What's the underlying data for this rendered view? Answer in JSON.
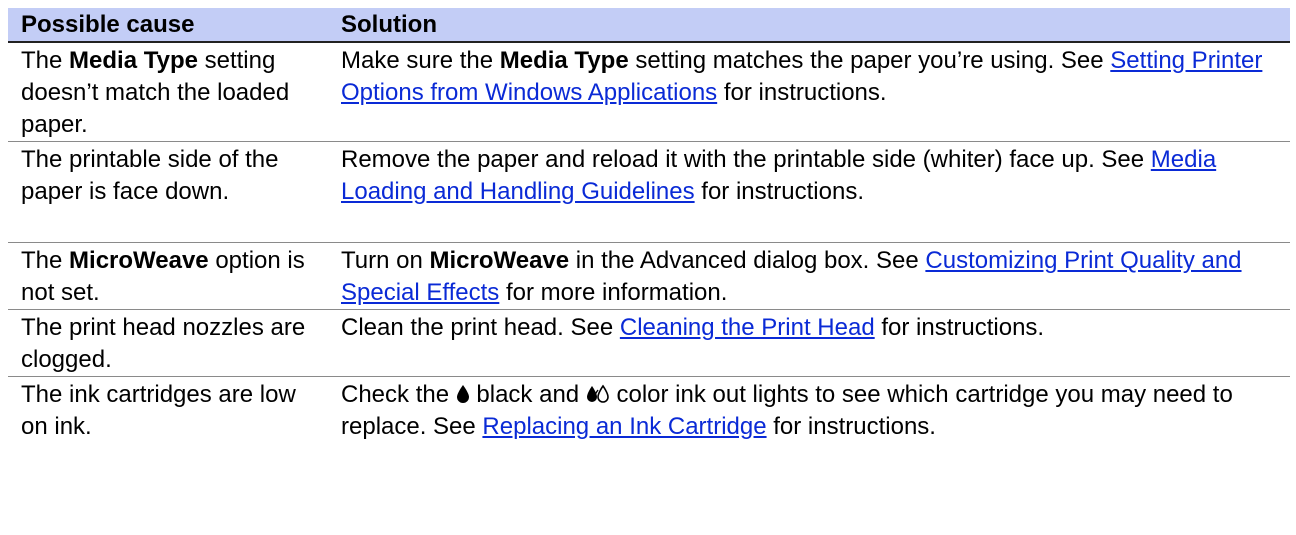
{
  "table": {
    "headers": {
      "cause": "Possible cause",
      "solution": "Solution"
    },
    "rows": [
      {
        "cause_pre": "The ",
        "cause_bold": "Media Type",
        "cause_post": " setting doesn’t match the loaded paper.",
        "sol_pre": "Make sure the ",
        "sol_bold": "Media Type",
        "sol_mid": " setting matches the paper you’re using. See ",
        "sol_link": "Setting Printer Options from Windows Applications",
        "sol_post": " for instructions."
      },
      {
        "cause": "The printable side of the paper is face down.",
        "sol_pre": "Remove the paper and reload it with the printable side (whiter) face up. See ",
        "sol_link": "Media Loading and Handling Guidelines",
        "sol_post": " for instructions."
      },
      {
        "cause_pre": "The ",
        "cause_bold": "MicroWeave",
        "cause_post": " option is not set.",
        "sol_pre": "Turn on ",
        "sol_bold": "MicroWeave",
        "sol_mid": " in the Advanced dialog box. See ",
        "sol_link": "Customizing Print Quality and Special Effects",
        "sol_post": " for more information."
      },
      {
        "cause": "The print head nozzles are clogged.",
        "sol_pre": "Clean the print head. See ",
        "sol_link": "Cleaning the Print Head",
        "sol_post": " for instructions."
      },
      {
        "cause": "The ink cartridges are low on ink.",
        "sol_pre": "Check the ",
        "black_drop_icon": "black-ink-drop-icon",
        "sol_mid1": " black and ",
        "color_drop_icon": "color-ink-drops-icon",
        "sol_mid2": " color ink out lights to see which cartridge you may need to replace. See ",
        "sol_link": "Replacing an Ink Cartridge",
        "sol_post": " for instructions."
      }
    ]
  },
  "colors": {
    "header_bg": "#c3cdf6",
    "link": "#0a2ad6"
  }
}
